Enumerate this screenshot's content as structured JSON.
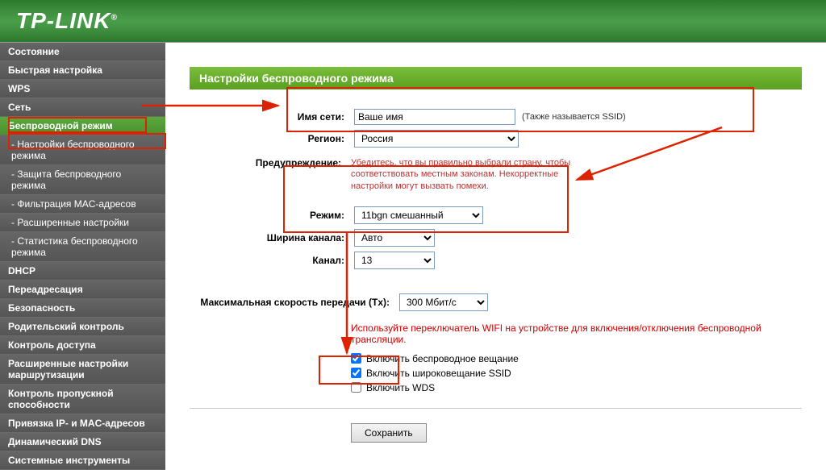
{
  "brand": "TP-LINK",
  "page_title": "Настройки беспроводного режима",
  "sidebar": {
    "items": [
      {
        "label": "Состояние"
      },
      {
        "label": "Быстрая настройка"
      },
      {
        "label": "WPS"
      },
      {
        "label": "Сеть"
      },
      {
        "label": "Беспроводной режим",
        "active": true
      },
      {
        "label": "- Настройки беспроводного режима",
        "sub": true
      },
      {
        "label": "- Защита беспроводного режима",
        "sub": true
      },
      {
        "label": "- Фильтрация MAC-адресов",
        "sub": true
      },
      {
        "label": "- Расширенные настройки",
        "sub": true
      },
      {
        "label": "- Статистика беспроводного режима",
        "sub": true
      },
      {
        "label": "DHCP"
      },
      {
        "label": "Переадресация"
      },
      {
        "label": "Безопасность"
      },
      {
        "label": "Родительский контроль"
      },
      {
        "label": "Контроль доступа"
      },
      {
        "label": "Расширенные настройки маршрутизации"
      },
      {
        "label": "Контроль пропускной способности"
      },
      {
        "label": "Привязка IP- и MAC-адресов"
      },
      {
        "label": "Динамический DNS"
      },
      {
        "label": "Системные инструменты"
      }
    ]
  },
  "labels": {
    "ssid": "Имя сети:",
    "region": "Регион:",
    "warning": "Предупреждение:",
    "mode": "Режим:",
    "channel_width": "Ширина канала:",
    "channel": "Канал:",
    "max_rate": "Максимальная скорость передачи (Tx):"
  },
  "fields": {
    "ssid": "Ваше имя",
    "ssid_hint": "(Также называется SSID)",
    "region": "Россия",
    "warning_text": "Убедитесь, что вы правильно выбрали страну, чтобы соответствовать местным законам. Некорректные настройки могут вызвать помехи.",
    "mode": "11bgn смешанный",
    "channel_width": "Авто",
    "channel": "13",
    "max_rate": "300 Мбит/с"
  },
  "wifi_note": "Используйте переключатель WIFI на устройстве для включения/отключения беспроводной трансляции.",
  "checkboxes": {
    "enable_wireless": "Включить беспроводное вещание",
    "enable_ssid_broadcast": "Включить широковещание SSID",
    "enable_wds": "Включить WDS"
  },
  "save": "Сохранить"
}
